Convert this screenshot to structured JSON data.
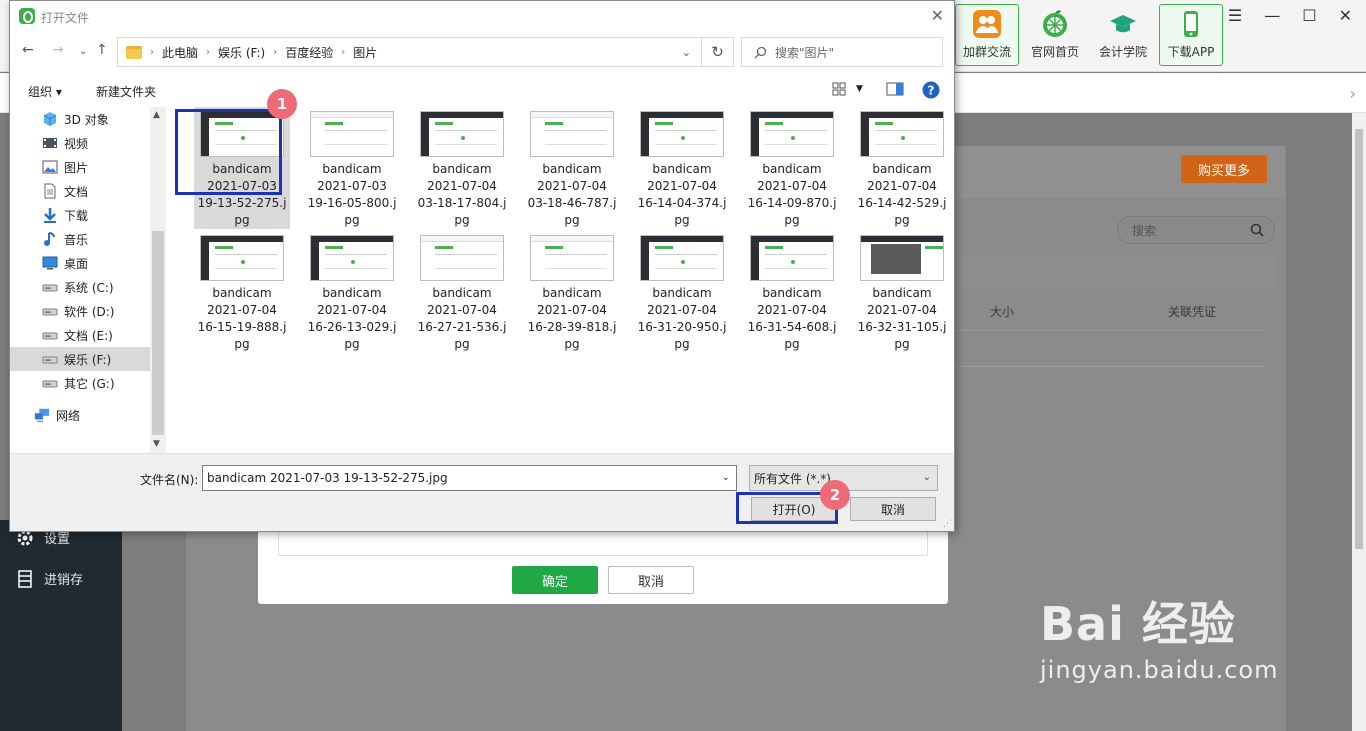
{
  "app": {
    "toolbar": [
      {
        "label": "加群交流",
        "name": "group-chat",
        "color": "#f18a1c"
      },
      {
        "label": "官网首页",
        "name": "official-home",
        "color": "#3aaf49"
      },
      {
        "label": "会计学院",
        "name": "accounting-academy",
        "color": "#1fa37a"
      },
      {
        "label": "下载APP",
        "name": "download-app",
        "color": "#3aaf49"
      }
    ],
    "buy_more": "购买更多",
    "search_placeholder": "搜索",
    "col_size": "大小",
    "col_voucher": "关联凭证",
    "sidebar": [
      {
        "label": "设置"
      },
      {
        "label": "进销存"
      }
    ],
    "confirm": "确定",
    "cancel": "取消"
  },
  "watermark": {
    "main": "Bai 经验",
    "sub": "jingyan.baidu.com"
  },
  "dialog": {
    "title": "打开文件",
    "breadcrumb": [
      "此电脑",
      "娱乐 (F:)",
      "百度经验",
      "图片"
    ],
    "search_placeholder": "搜索\"图片\"",
    "organize": "组织 ▾",
    "new_folder": "新建文件夹",
    "nav": [
      {
        "label": "3D 对象",
        "icon": "cube-icon"
      },
      {
        "label": "视频",
        "icon": "video-icon"
      },
      {
        "label": "图片",
        "icon": "picture-icon"
      },
      {
        "label": "文档",
        "icon": "document-icon"
      },
      {
        "label": "下载",
        "icon": "download-icon"
      },
      {
        "label": "音乐",
        "icon": "music-icon"
      },
      {
        "label": "桌面",
        "icon": "desktop-icon"
      },
      {
        "label": "系统 (C:)",
        "icon": "drive-icon"
      },
      {
        "label": "软件 (D:)",
        "icon": "drive-icon"
      },
      {
        "label": "文档 (E:)",
        "icon": "drive-icon"
      },
      {
        "label": "娱乐 (F:)",
        "icon": "drive-icon",
        "selected": true
      },
      {
        "label": "其它 (G:)",
        "icon": "drive-icon"
      },
      {
        "label": "网络",
        "icon": "network-icon"
      }
    ],
    "files": [
      {
        "l1": "bandicam",
        "l2": "2021-07-03",
        "l3": "19-13-52-275.j",
        "l4": "pg",
        "selected": true
      },
      {
        "l1": "bandicam",
        "l2": "2021-07-03",
        "l3": "19-16-05-800.j",
        "l4": "pg"
      },
      {
        "l1": "bandicam",
        "l2": "2021-07-04",
        "l3": "03-18-17-804.j",
        "l4": "pg"
      },
      {
        "l1": "bandicam",
        "l2": "2021-07-04",
        "l3": "03-18-46-787.j",
        "l4": "pg"
      },
      {
        "l1": "bandicam",
        "l2": "2021-07-04",
        "l3": "16-14-04-374.j",
        "l4": "pg"
      },
      {
        "l1": "bandicam",
        "l2": "2021-07-04",
        "l3": "16-14-09-870.j",
        "l4": "pg"
      },
      {
        "l1": "bandicam",
        "l2": "2021-07-04",
        "l3": "16-14-42-529.j",
        "l4": "pg"
      },
      {
        "l1": "bandicam",
        "l2": "2021-07-04",
        "l3": "16-15-19-888.j",
        "l4": "pg"
      },
      {
        "l1": "bandicam",
        "l2": "2021-07-04",
        "l3": "16-26-13-029.j",
        "l4": "pg"
      },
      {
        "l1": "bandicam",
        "l2": "2021-07-04",
        "l3": "16-27-21-536.j",
        "l4": "pg"
      },
      {
        "l1": "bandicam",
        "l2": "2021-07-04",
        "l3": "16-28-39-818.j",
        "l4": "pg"
      },
      {
        "l1": "bandicam",
        "l2": "2021-07-04",
        "l3": "16-31-20-950.j",
        "l4": "pg"
      },
      {
        "l1": "bandicam",
        "l2": "2021-07-04",
        "l3": "16-31-54-608.j",
        "l4": "pg"
      },
      {
        "l1": "bandicam",
        "l2": "2021-07-04",
        "l3": "16-32-31-105.j",
        "l4": "pg"
      }
    ],
    "filename_label": "文件名(N):",
    "filename_value": "bandicam 2021-07-03 19-13-52-275.jpg",
    "filetype": "所有文件 (*.*)",
    "open": "打开(O)",
    "cancel": "取消"
  },
  "badges": [
    "1",
    "2"
  ],
  "colors": {
    "highlight": "#1b33b8",
    "badge": "#ef6a77",
    "green": "#20a845",
    "orange": "#d36316"
  }
}
